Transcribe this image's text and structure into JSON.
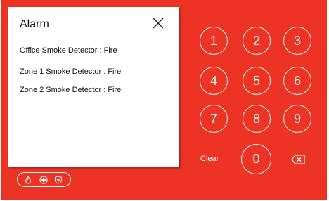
{
  "alarm": {
    "title": "Alarm",
    "items": [
      "Office Smoke Detector : Fire",
      "Zone 1 Smoke Detector : Fire",
      "Zone 2 Smoke Detector : Fire"
    ]
  },
  "keypad": {
    "keys": [
      "1",
      "2",
      "3",
      "4",
      "5",
      "6",
      "7",
      "8",
      "9",
      "0"
    ],
    "clear_label": "Clear",
    "backspace_icon": "backspace-icon"
  },
  "status_icons": [
    "fire-icon",
    "medical-icon",
    "police-badge-icon"
  ],
  "colors": {
    "background": "#ec3324",
    "panel": "#ffffff",
    "text": "#111111"
  }
}
